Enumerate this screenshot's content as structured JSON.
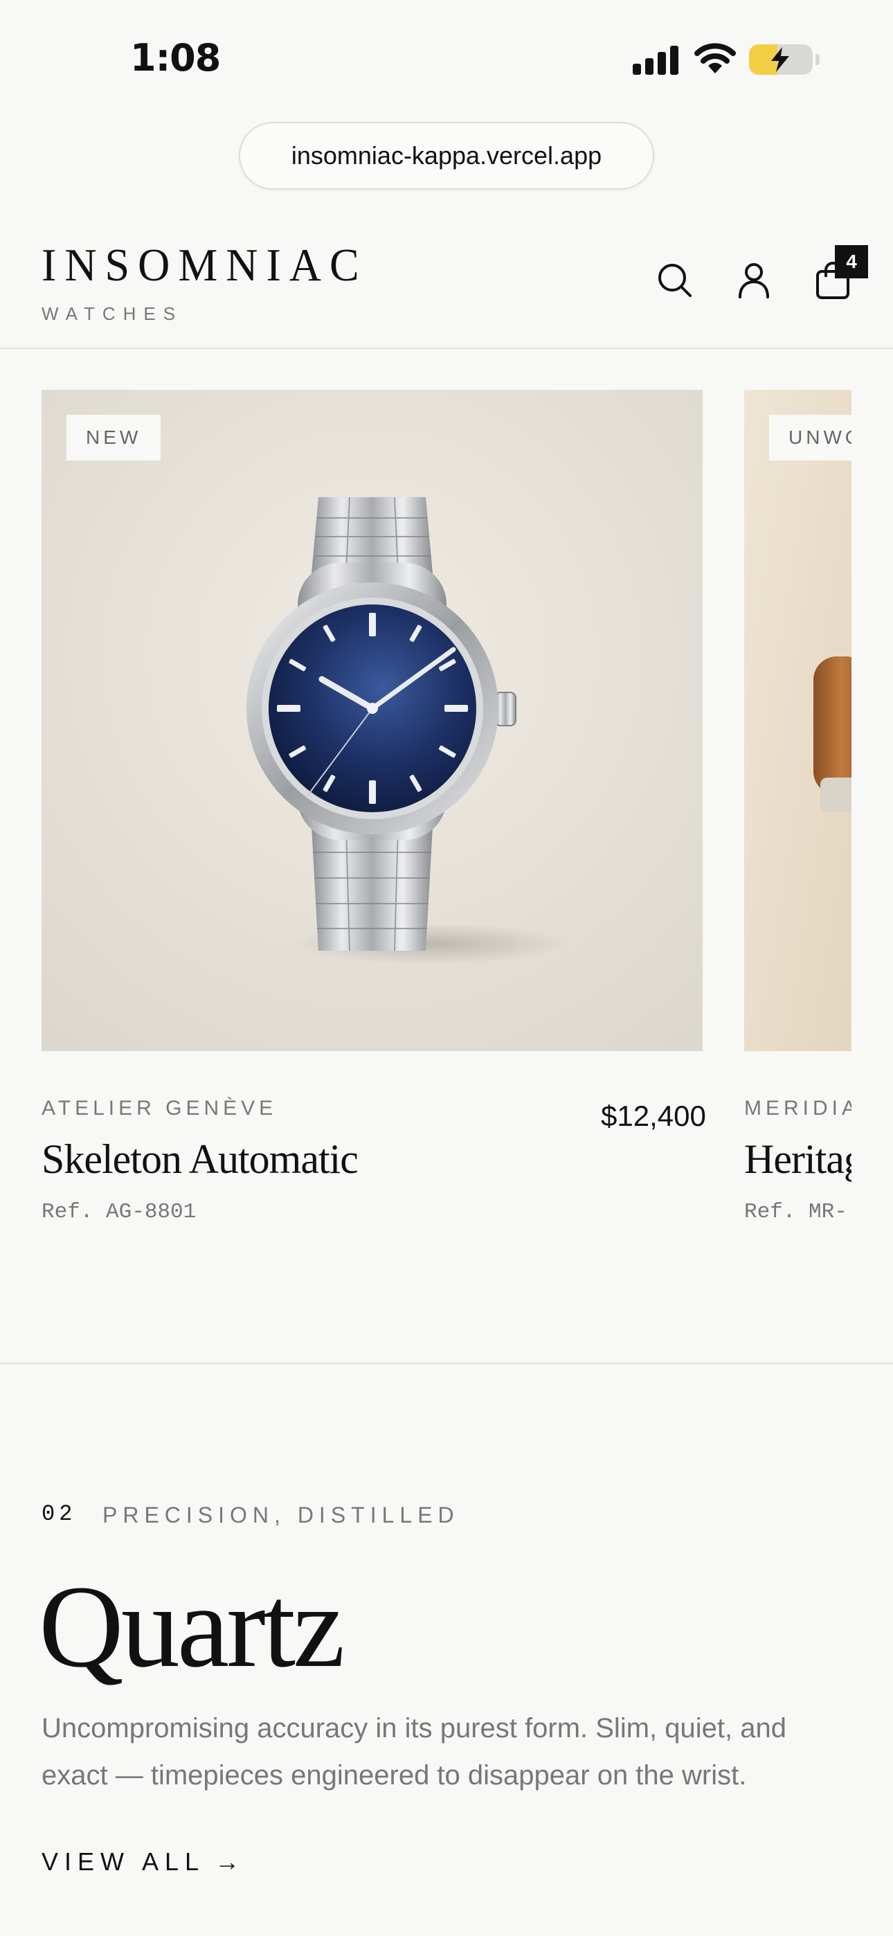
{
  "status_bar": {
    "time": "1:08",
    "battery_level": 0.45,
    "battery_charging": true
  },
  "browser": {
    "url": "insomniac-kappa.vercel.app"
  },
  "header": {
    "logo": "INSOMNIAC",
    "logo_sub": "WATCHES",
    "icons": [
      "search-icon",
      "account-icon",
      "bag-icon"
    ],
    "cart_count": "4"
  },
  "products": [
    {
      "tag": "NEW",
      "brand": "ATELIER GENÈVE",
      "name": "Skeleton Automatic",
      "ref": "Ref. AG-8801",
      "price": "$12,400"
    },
    {
      "tag": "UNWO",
      "brand": "MERIDIA",
      "name": "Heritage",
      "ref": "Ref. MR-",
      "price": ""
    }
  ],
  "collection": {
    "number": "02",
    "kicker": "PRECISION, DISTILLED",
    "title": "Quartz",
    "description": "Uncompromising accuracy in its purest form. Slim, quiet, and exact — timepieces engineered to disappear on the wrist.",
    "cta": "VIEW ALL",
    "cta_arrow": "→"
  },
  "colors": {
    "background": "#f8f8f6",
    "text": "#111111",
    "muted": "#777777",
    "dial": "#1b2d5e",
    "badge": "#111111",
    "battery": "#f2ce45"
  }
}
